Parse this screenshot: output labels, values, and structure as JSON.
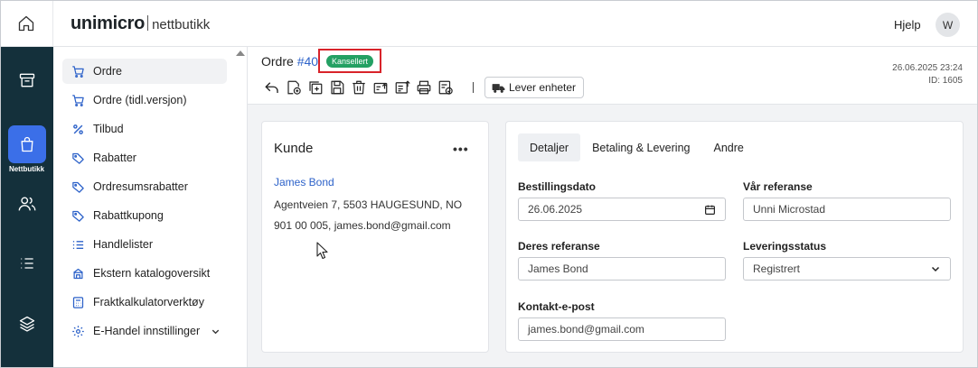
{
  "header": {
    "brand_name": "unimicro",
    "brand_sub": "nettbutikk",
    "help": "Hjelp",
    "avatar": "W"
  },
  "rail": {
    "items": [
      {
        "icon": "home-icon"
      },
      {
        "icon": "archive-icon"
      },
      {
        "icon": "shopping-bag-icon",
        "label": "Nettbutikk",
        "active": true
      },
      {
        "icon": "users-icon"
      },
      {
        "icon": "list-icon"
      },
      {
        "icon": "layers-icon"
      }
    ]
  },
  "sidebar": {
    "items": [
      {
        "label": "Ordre",
        "icon": "cart-icon",
        "active": true
      },
      {
        "label": "Ordre (tidl.versjon)",
        "icon": "cart-icon"
      },
      {
        "label": "Tilbud",
        "icon": "percent-icon"
      },
      {
        "label": "Rabatter",
        "icon": "tag-icon"
      },
      {
        "label": "Ordresumsrabatter",
        "icon": "tag-icon"
      },
      {
        "label": "Rabattkupong",
        "icon": "tag-icon"
      },
      {
        "label": "Handlelister",
        "icon": "list-icon"
      },
      {
        "label": "Ekstern katalogoversikt",
        "icon": "catalog-icon"
      },
      {
        "label": "Fraktkalkulatorverktøy",
        "icon": "calculator-icon"
      },
      {
        "label": "E-Handel innstillinger",
        "icon": "settings-icon"
      }
    ]
  },
  "order": {
    "title_prefix": "Ordre",
    "number": "#40",
    "status": "Kansellert",
    "status_color": "#24a063",
    "date": "26.06.2025 23:24",
    "id": "ID: 1605",
    "deliver_label": "Lever enheter"
  },
  "customer": {
    "title": "Kunde",
    "name": "James Bond",
    "address": "Agentveien 7, 5503 HAUGESUND, NO",
    "contact": "901 00 005, james.bond@gmail.com"
  },
  "details": {
    "tabs": [
      "Detaljer",
      "Betaling & Levering",
      "Andre"
    ],
    "order_date_label": "Bestillingsdato",
    "order_date": "26.06.2025",
    "our_ref_label": "Vår referanse",
    "our_ref": "Unni Microstad",
    "their_ref_label": "Deres referanse",
    "their_ref": "James Bond",
    "delivery_status_label": "Leveringsstatus",
    "delivery_status": "Registrert",
    "contact_email_label": "Kontakt-e-post",
    "contact_email": "james.bond@gmail.com"
  },
  "colors": {
    "accent": "#3b6fe8",
    "rail_bg": "#14303b",
    "link": "#2d62c9",
    "alert_outline": "#d8232a"
  }
}
